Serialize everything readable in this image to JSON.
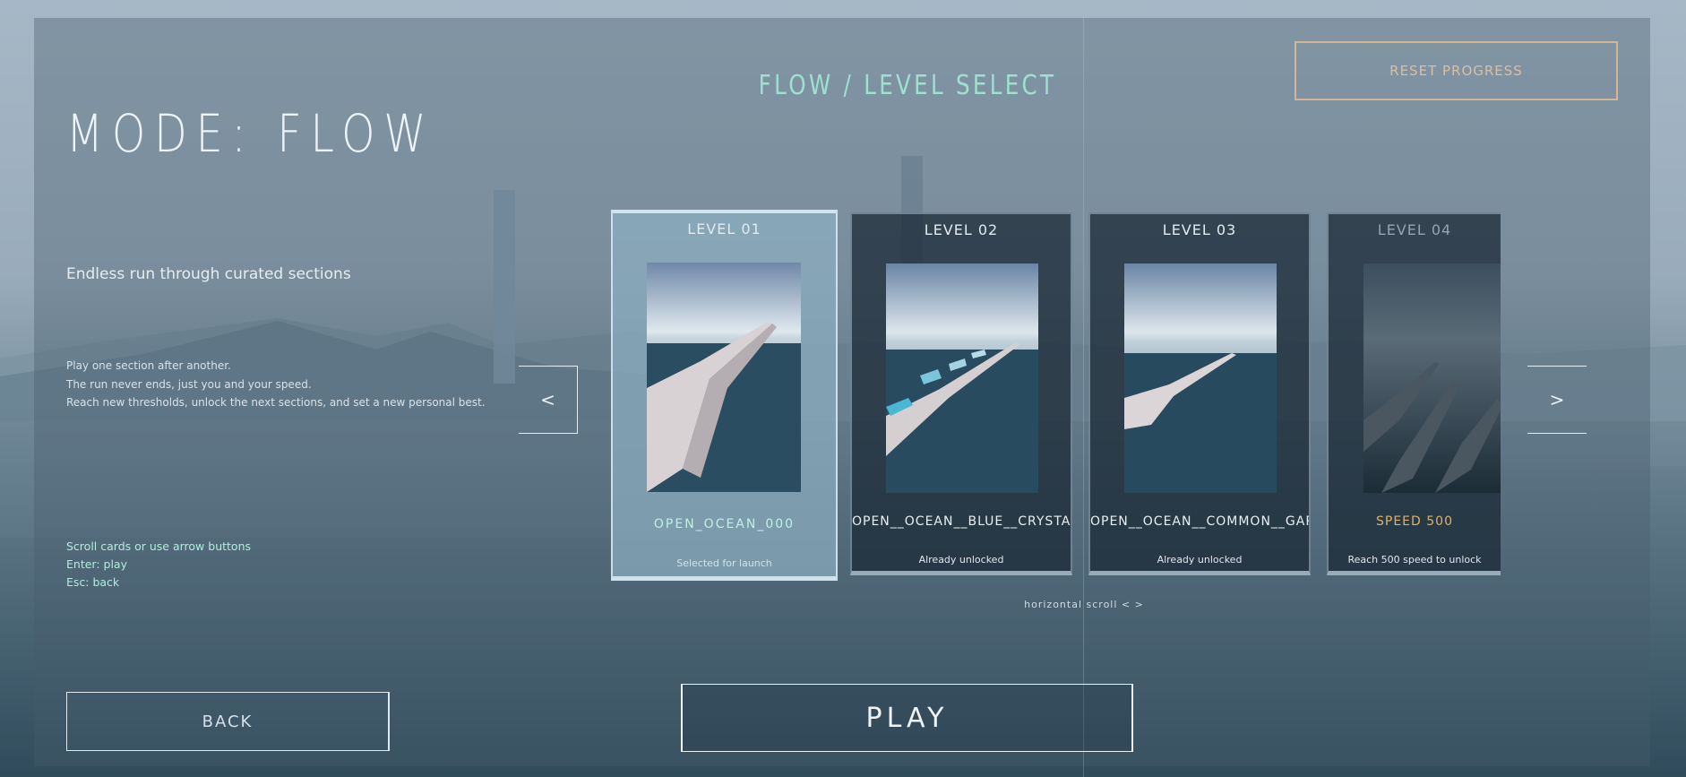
{
  "mode_title": "MODE: FLOW",
  "header_title": "FLOW / LEVEL SELECT",
  "reset_label": "RESET PROGRESS",
  "subtitle": "Endless run through curated sections",
  "description": [
    "Play one section after another.",
    "The run never ends, just you and your speed.",
    "Reach new thresholds, unlock the next sections, and set a new personal best."
  ],
  "hints": [
    "Scroll cards or use arrow buttons",
    "Enter: play",
    "Esc: back"
  ],
  "nav": {
    "prev": "<",
    "next": ">"
  },
  "levels": [
    {
      "level": "LEVEL 01",
      "name": "OPEN_OCEAN_000",
      "status": "Selected for launch",
      "state": "selected"
    },
    {
      "level": "LEVEL 02",
      "name": "OPEN__OCEAN__BLUE__CRYSTALS",
      "status": "Already unlocked",
      "state": "unlocked"
    },
    {
      "level": "LEVEL 03",
      "name": "OPEN__OCEAN__COMMON__GAPS",
      "status": "Already unlocked",
      "state": "unlocked"
    },
    {
      "level": "LEVEL 04",
      "name": "SPEED 500",
      "status": "Reach 500 speed to unlock",
      "state": "locked"
    }
  ],
  "scroll_hint": "horizontal scroll < >",
  "back_label": "BACK",
  "play_label": "PLAY",
  "colors": {
    "accent_mint": "#9fe0cf",
    "reset_border": "#d4b596",
    "locked_gold": "#e0b06a"
  }
}
